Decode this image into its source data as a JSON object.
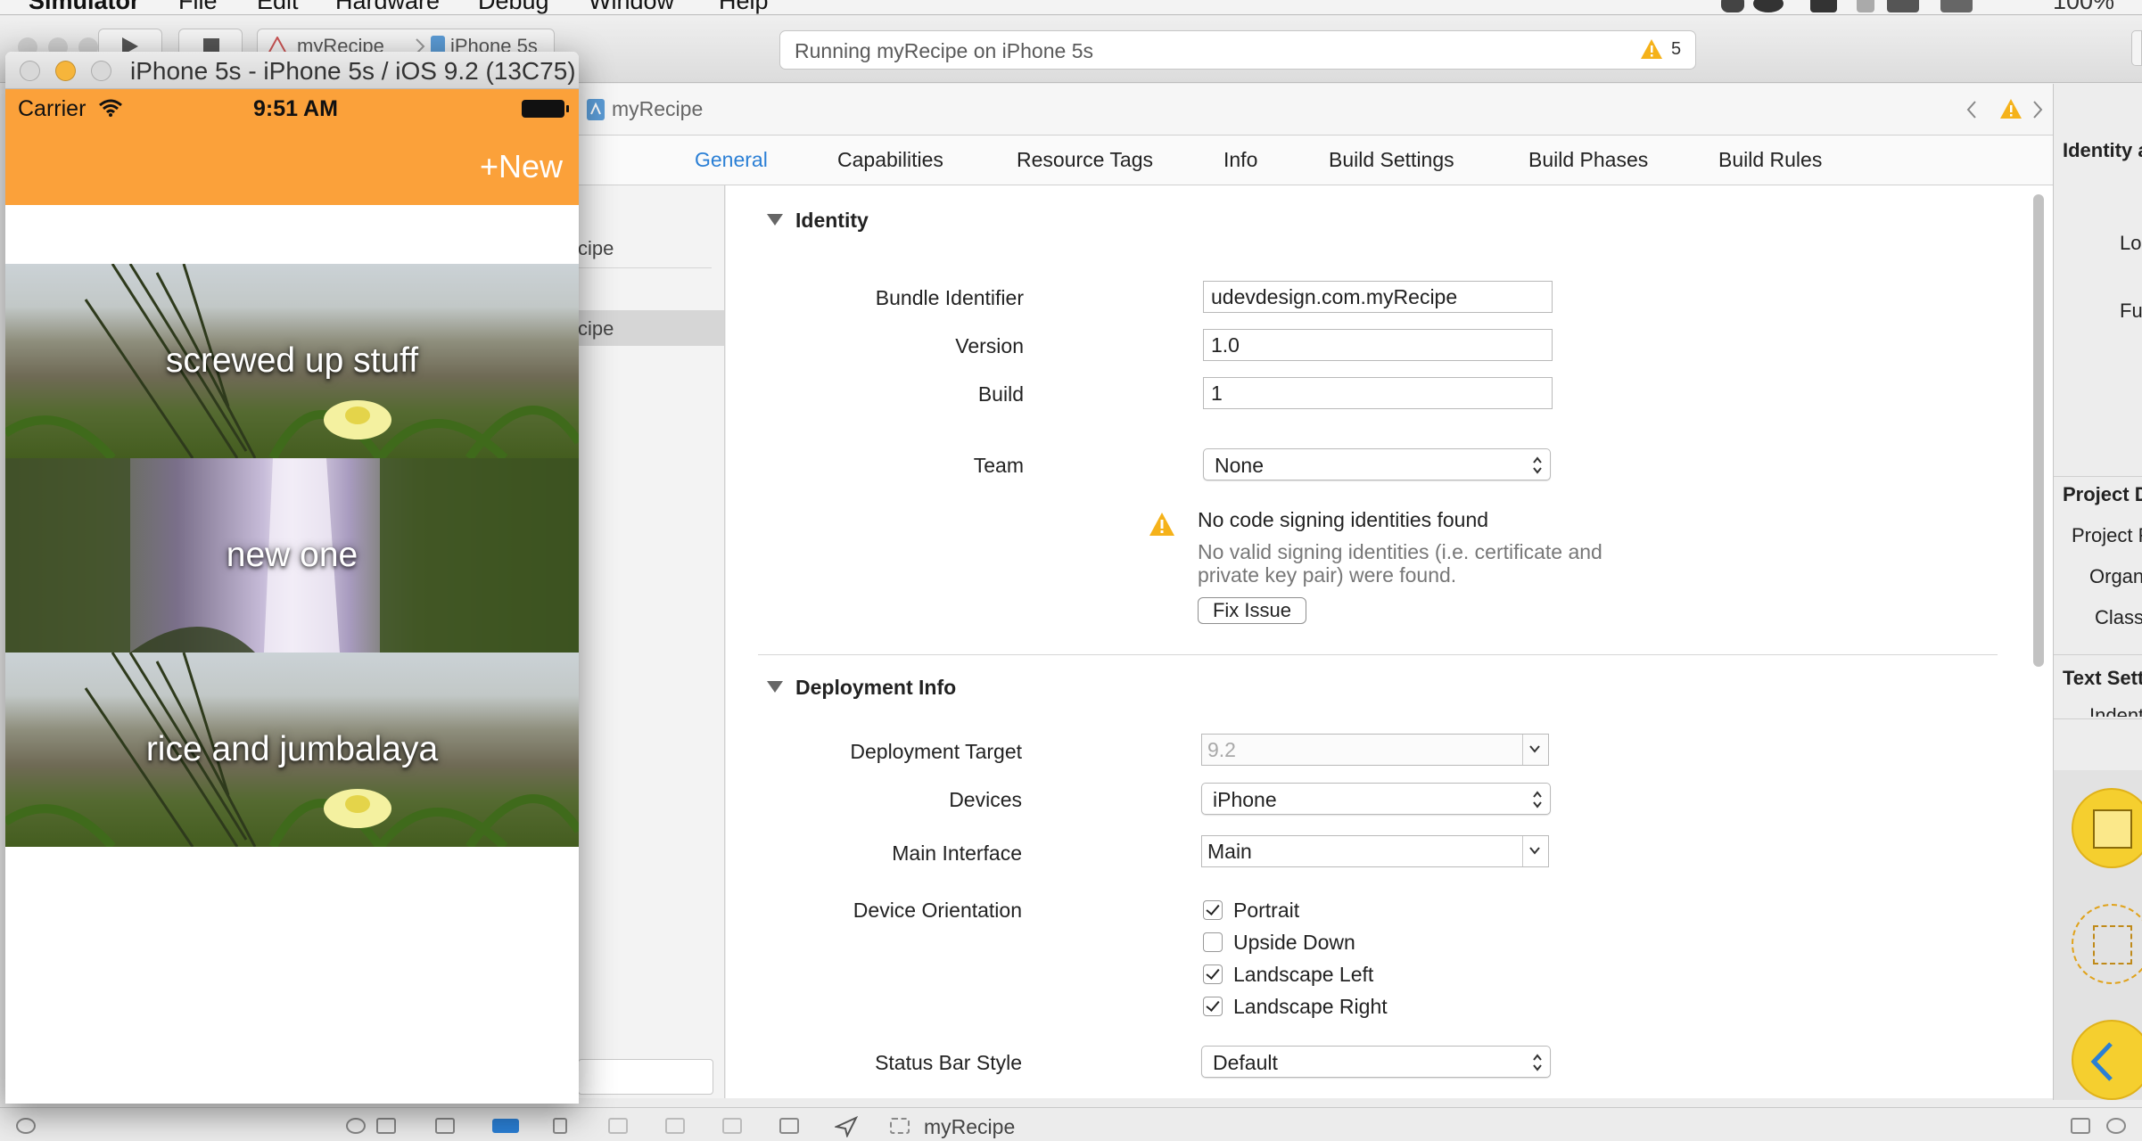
{
  "menubar": {
    "app_name": "Simulator",
    "items": [
      "File",
      "Edit",
      "Hardware",
      "Debug",
      "Window",
      "Help"
    ],
    "battery_text": "100%"
  },
  "toolbar": {
    "activity_text": "Running myRecipe on iPhone 5s",
    "warning_count": "5",
    "scheme_name": "myRecipe",
    "destination": "iPhone 5s"
  },
  "jumpbar": {
    "project": "myRecipe"
  },
  "tabs": [
    {
      "label": "General",
      "active": true
    },
    {
      "label": "Capabilities",
      "active": false
    },
    {
      "label": "Resource Tags",
      "active": false
    },
    {
      "label": "Info",
      "active": false
    },
    {
      "label": "Build Settings",
      "active": false
    },
    {
      "label": "Build Phases",
      "active": false
    },
    {
      "label": "Build Rules",
      "active": false
    }
  ],
  "target_list": {
    "items": [
      "cipe",
      "cipe"
    ]
  },
  "identity": {
    "header": "Identity",
    "bundle_label": "Bundle Identifier",
    "bundle_value": "udevdesign.com.myRecipe",
    "version_label": "Version",
    "version_value": "1.0",
    "build_label": "Build",
    "build_value": "1",
    "team_label": "Team",
    "team_value": "None",
    "warning_title": "No code signing identities found",
    "warning_desc": "No valid signing identities (i.e. certificate and private key pair) were found.",
    "fix_button": "Fix Issue"
  },
  "deployment": {
    "header": "Deployment Info",
    "target_label": "Deployment Target",
    "target_value": "9.2",
    "devices_label": "Devices",
    "devices_value": "iPhone",
    "main_label": "Main Interface",
    "main_value": "Main",
    "orientation_label": "Device Orientation",
    "orientations": [
      {
        "label": "Portrait",
        "checked": true
      },
      {
        "label": "Upside Down",
        "checked": false
      },
      {
        "label": "Landscape Left",
        "checked": true
      },
      {
        "label": "Landscape Right",
        "checked": true
      }
    ],
    "statusbar_label": "Status Bar Style",
    "statusbar_value": "Default"
  },
  "inspector": {
    "identity_head": "Identity a",
    "row1": "Lo",
    "row2": "Fu",
    "project_head": "Project D",
    "project_rows": [
      "Project F",
      "Organ",
      "Class"
    ],
    "text_head": "Text Sett",
    "text_row": "Indent"
  },
  "debugbar": {
    "app_name": "myRecipe"
  },
  "simulator": {
    "window_title": "iPhone 5s - iPhone 5s / iOS 9.2 (13C75)",
    "carrier": "Carrier",
    "time": "9:51 AM",
    "nav_button": "+New",
    "nav_color": "#fba13a",
    "recipes": [
      "screwed up stuff",
      "new one",
      "rice and jumbalaya"
    ]
  },
  "colors": {
    "accent": "#2a7fd5",
    "warning": "#f5b21a"
  }
}
